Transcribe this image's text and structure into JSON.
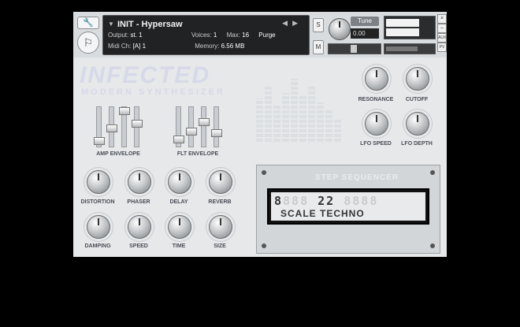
{
  "header": {
    "instrument_name": "INIT - Hypersaw",
    "output_label": "Output:",
    "output_value": "st. 1",
    "voices_label": "Voices:",
    "voices_value": "1",
    "max_label": "Max:",
    "max_value": "16",
    "purge_label": "Purge",
    "midi_label": "Midi Ch:",
    "midi_value": "[A] 1",
    "memory_label": "Memory:",
    "memory_value": "6.56 MB",
    "s_button": "S",
    "m_button": "M",
    "tune_label": "Tune",
    "tune_value": "0.00",
    "aux_label": "AUX",
    "pv_label": "PV"
  },
  "brand": {
    "title": "INFECTED",
    "subtitle": "MODERN SYNTHESIZER"
  },
  "envelopes": {
    "amp_label": "AMP ENVELOPE",
    "flt_label": "FLT ENVELOPE"
  },
  "filter_knobs": [
    {
      "label": "RESONANCE"
    },
    {
      "label": "CUTOFF"
    },
    {
      "label": "LFO SPEED"
    },
    {
      "label": "LFO DEPTH"
    }
  ],
  "fx_knobs": [
    {
      "label": "DISTORTION"
    },
    {
      "label": "PHASER"
    },
    {
      "label": "DELAY"
    },
    {
      "label": "REVERB"
    },
    {
      "label": "DAMPING"
    },
    {
      "label": "SPEED"
    },
    {
      "label": "TIME"
    },
    {
      "label": "SIZE"
    }
  ],
  "sequencer": {
    "title": "STEP SEQUENCER",
    "steps_text": "8",
    "steps_pattern": "  22  ",
    "scale_text": "SCALE TECHNO"
  }
}
